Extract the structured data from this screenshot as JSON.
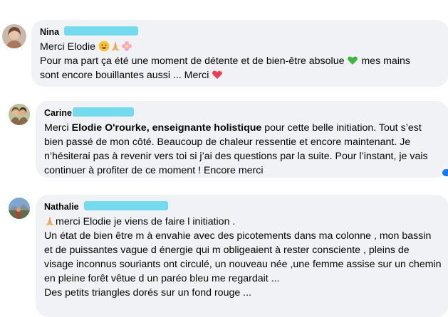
{
  "comments": [
    {
      "author": "Nina",
      "lines": [
        {
          "segments": [
            {
              "t": "Merci Elodie "
            }
          ],
          "emojis": [
            "grin-emoji",
            "pray-emoji",
            "flower-emoji"
          ]
        },
        {
          "segments": [
            {
              "t": "Pour ma part ça été une moment de détente et de bien-être absolue "
            }
          ],
          "trailing_emoji": "green-heart-emoji",
          "after": " mes mains"
        },
        {
          "segments": [
            {
              "t": "sont encore bouillantes aussi ... Merci "
            }
          ],
          "trailing_emoji": "sparkling-heart-emoji"
        }
      ]
    },
    {
      "author": "Carine",
      "line1_pre": "Merci ",
      "line1_bold": "Elodie O'rourke, enseignante holistique",
      "line1_post": " pour cette belle initiation. Tout s’est",
      "line2": "bien passé de mon côté. Beaucoup de chaleur ressentie et encore maintenant. Je",
      "line3": "n’hésiterai pas à revenir vers toi si j’ai des questions par la suite. Pour l’instant, je vais",
      "line4": "continuer à profiter de ce moment ! Encore merci"
    },
    {
      "author": "Nathalie",
      "line1": "merci Elodie je viens de faire l initiation .",
      "line2": "Un état de bien être m à envahie avec des picotements dans ma colonne , mon bassin",
      "line3": "et de puissantes vague d énergie qui m obligeaient à rester consciente , pleins de",
      "line4": "visage inconnus souriants ont circulé, un nouveau née ,une femme assise sur un chemin",
      "line5": "en pleine forêt vêtue d un paréo bleu me regardait ...",
      "line6": "Des petits triangles dorés sur un fond rouge ..."
    }
  ],
  "n1": {
    "l1": "Merci Elodie ",
    "l2a": "Pour ma part ça été une moment de détente et de bien-être absolue ",
    "l2b": " mes mains",
    "l3": "sont encore bouillantes aussi ... Merci "
  },
  "colors": {
    "bubble": "#f0f2f5",
    "redaction": "#5ed6ec",
    "text": "#050505"
  }
}
